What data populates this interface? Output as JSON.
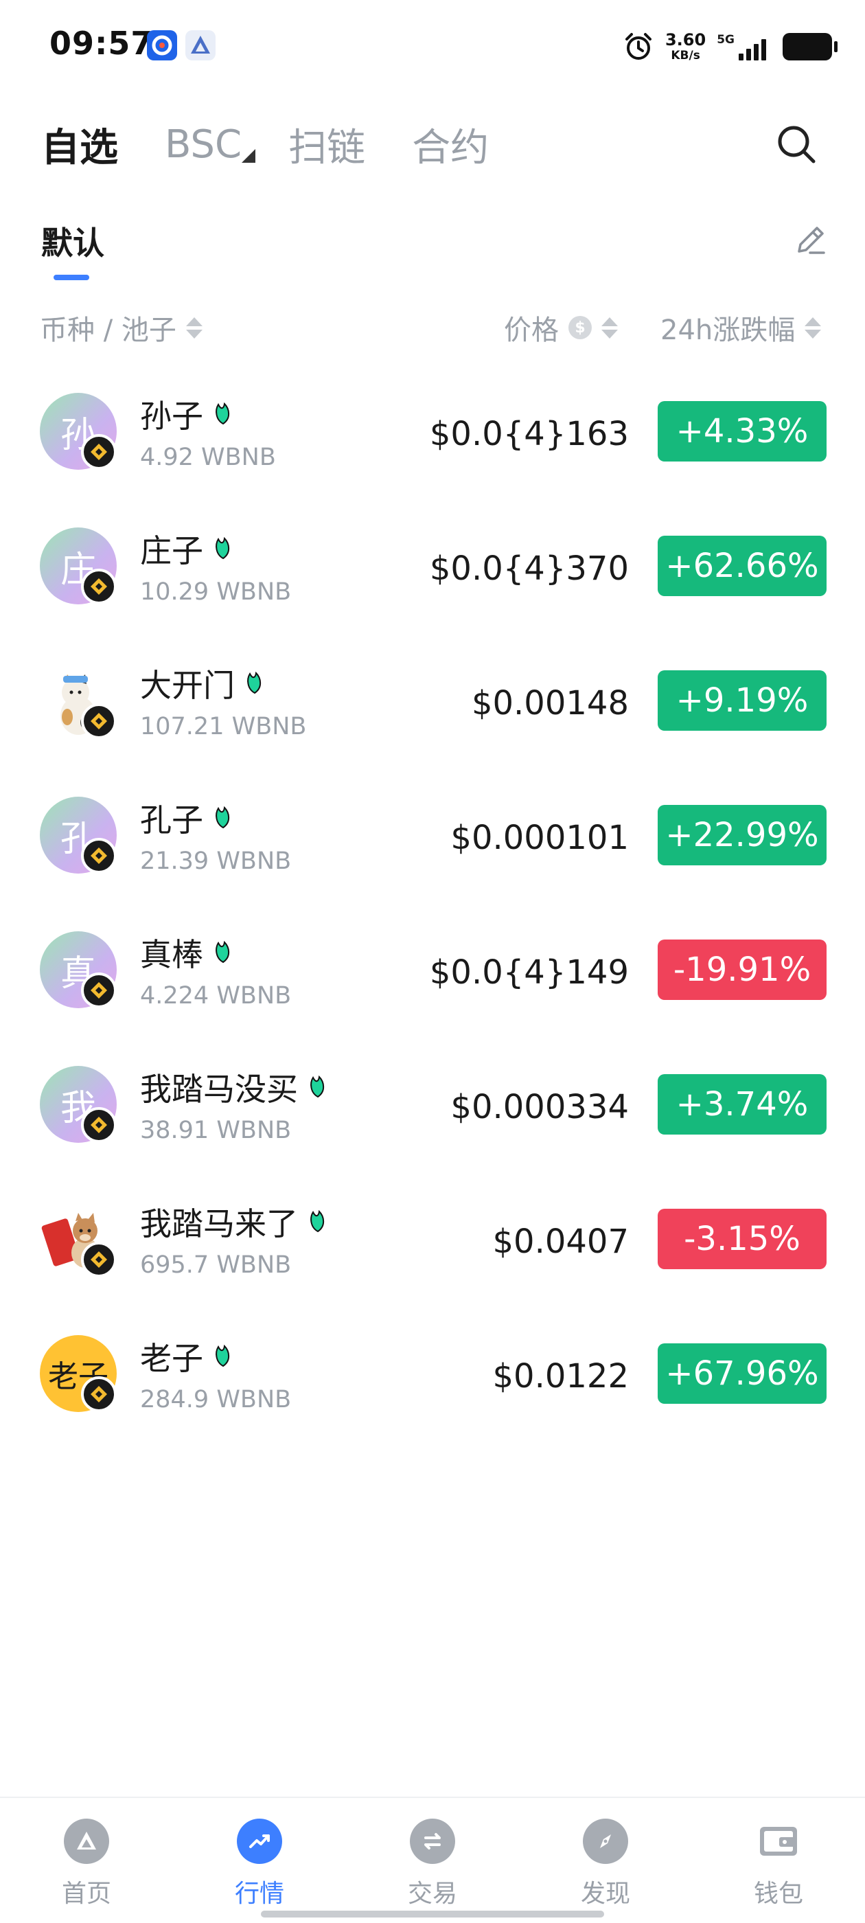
{
  "status_bar": {
    "time": "09:57",
    "net_speed_value": "3.60",
    "net_speed_unit": "KB/s",
    "network_type": "5G"
  },
  "top_tabs": [
    {
      "label": "自选",
      "active": true
    },
    {
      "label": "BSC",
      "active": false
    },
    {
      "label": "扫链",
      "active": false
    },
    {
      "label": "合约",
      "active": false
    }
  ],
  "sub_tab": {
    "label": "默认"
  },
  "columns": {
    "token_pool": "币种 / 池子",
    "price": "价格",
    "price_currency_icon": "$",
    "change": "24h涨跌幅"
  },
  "tokens": [
    {
      "avatar_text": "孙",
      "name": "孙子",
      "pool": "4.92 WBNB",
      "price": "$0.0{4}163",
      "change": "+4.33%",
      "direction": "up"
    },
    {
      "avatar_text": "庄",
      "name": "庄子",
      "pool": "10.29 WBNB",
      "price": "$0.0{4}370",
      "change": "+62.66%",
      "direction": "up"
    },
    {
      "avatar_text": "",
      "name": "大开门",
      "pool": "107.21 WBNB",
      "price": "$0.00148",
      "change": "+9.19%",
      "direction": "up"
    },
    {
      "avatar_text": "孔",
      "name": "孔子",
      "pool": "21.39 WBNB",
      "price": "$0.000101",
      "change": "+22.99%",
      "direction": "up"
    },
    {
      "avatar_text": "真",
      "name": "真棒",
      "pool": "4.224 WBNB",
      "price": "$0.0{4}149",
      "change": "-19.91%",
      "direction": "down"
    },
    {
      "avatar_text": "我",
      "name": "我踏马没买",
      "pool": "38.91 WBNB",
      "price": "$0.000334",
      "change": "+3.74%",
      "direction": "up"
    },
    {
      "avatar_text": "",
      "name": "我踏马来了",
      "pool": "695.7 WBNB",
      "price": "$0.0407",
      "change": "-3.15%",
      "direction": "down"
    },
    {
      "avatar_text": "老子",
      "name": "老子",
      "pool": "284.9 WBNB",
      "price": "$0.0122",
      "change": "+67.96%",
      "direction": "up"
    }
  ],
  "bottom_nav": [
    {
      "label": "首页",
      "icon": "home-icon",
      "active": false
    },
    {
      "label": "行情",
      "icon": "market-trend-icon",
      "active": true
    },
    {
      "label": "交易",
      "icon": "swap-icon",
      "active": false
    },
    {
      "label": "发现",
      "icon": "compass-icon",
      "active": false
    },
    {
      "label": "钱包",
      "icon": "wallet-icon",
      "active": false
    }
  ],
  "colors": {
    "accent": "#3d7fff",
    "up": "#16b97c",
    "down": "#f0425a",
    "muted": "#9aa0a8"
  }
}
